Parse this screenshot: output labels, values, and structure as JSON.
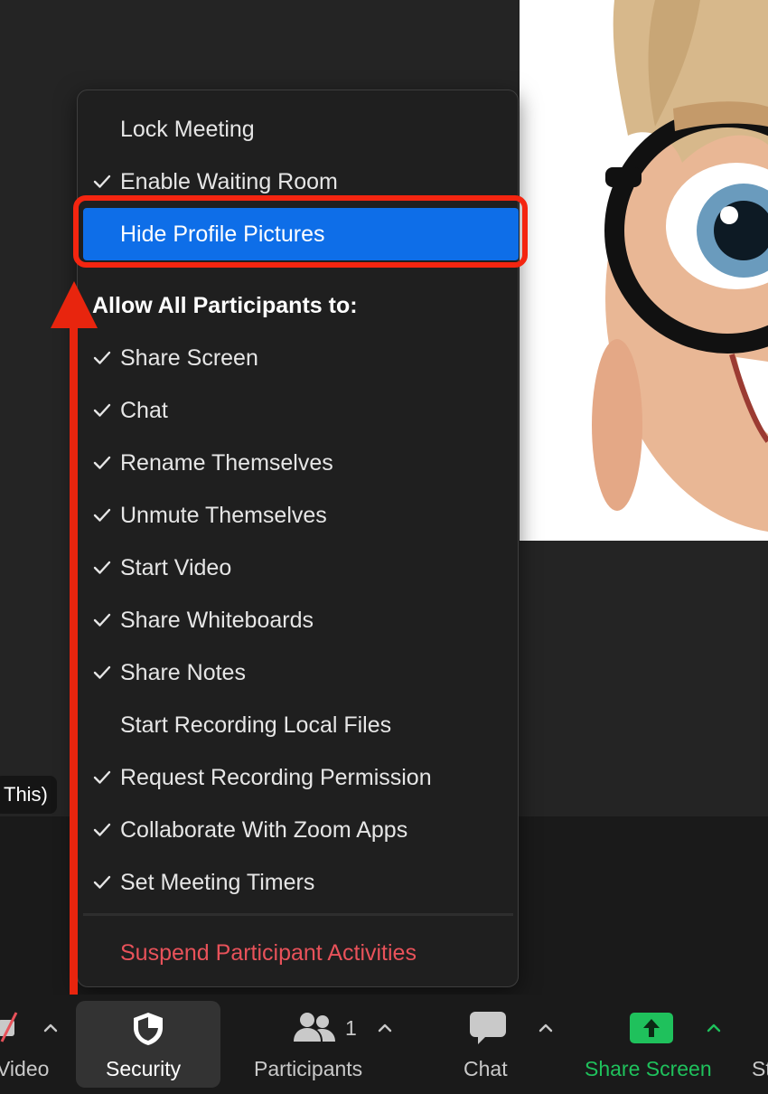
{
  "app": "Zoom",
  "menu": {
    "items_top": [
      {
        "label": "Lock Meeting",
        "checked": false
      },
      {
        "label": "Enable Waiting Room",
        "checked": true
      },
      {
        "label": "Hide Profile Pictures",
        "checked": false,
        "selected": true
      }
    ],
    "section_heading": "Allow All Participants to:",
    "items_allow": [
      {
        "label": "Share Screen",
        "checked": true
      },
      {
        "label": "Chat",
        "checked": true
      },
      {
        "label": "Rename Themselves",
        "checked": true
      },
      {
        "label": "Unmute Themselves",
        "checked": true
      },
      {
        "label": "Start Video",
        "checked": true
      },
      {
        "label": "Share Whiteboards",
        "checked": true
      },
      {
        "label": "Share Notes",
        "checked": true
      },
      {
        "label": "Start Recording Local Files",
        "checked": false
      },
      {
        "label": "Request Recording Permission",
        "checked": true
      },
      {
        "label": "Collaborate With Zoom Apps",
        "checked": true
      },
      {
        "label": "Set Meeting Timers",
        "checked": true
      }
    ],
    "danger_item": "Suspend Participant Activities"
  },
  "participant_name_tag": "This)",
  "toolbar": {
    "video_label": "Video",
    "security_label": "Security",
    "participants_label": "Participants",
    "participants_count": "1",
    "chat_label": "Chat",
    "share_label": "Share Screen",
    "next_label_partial": "St"
  },
  "colors": {
    "accent_blue": "#0e6ee8",
    "annotation_red": "#f42510",
    "danger": "#e8525a",
    "share_green": "#1fc15c"
  }
}
